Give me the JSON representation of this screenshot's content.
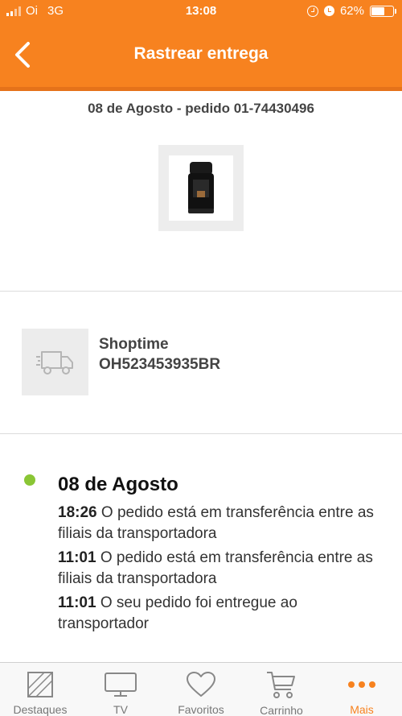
{
  "status_bar": {
    "carrier": "Oi",
    "network": "3G",
    "time": "13:08",
    "battery_percent_label": "62%",
    "battery_level": 0.62
  },
  "header": {
    "title": "Rastrear entrega",
    "back_icon": "chevron-left-icon"
  },
  "order": {
    "summary": "08 de Agosto - pedido 01-74430496",
    "product_image": "coffee-machine"
  },
  "carrier": {
    "icon": "truck-icon",
    "name": "Shoptime",
    "tracking_code": "OH523453935BR"
  },
  "timeline": {
    "date": "08 de Agosto",
    "dot_color": "#8ac635",
    "events": [
      {
        "time": "18:26",
        "text": " O pedido está em transferência entre as filiais da transportadora"
      },
      {
        "time": "11:01",
        "text": " O pedido está em transferência entre as filiais da transportadora"
      },
      {
        "time": "11:01",
        "text": " O seu pedido foi entregue ao transportador"
      }
    ]
  },
  "bottom_nav": {
    "items": [
      {
        "label": "Destaques",
        "icon": "destaques-icon"
      },
      {
        "label": "TV",
        "icon": "tv-icon"
      },
      {
        "label": "Favoritos",
        "icon": "heart-icon"
      },
      {
        "label": "Carrinho",
        "icon": "cart-icon"
      },
      {
        "label": "Mais",
        "icon": "more-dots-icon"
      }
    ],
    "active_index": 4
  },
  "colors": {
    "brand_orange": "#f7821f",
    "success_green": "#8ac635",
    "nav_inactive": "#777777"
  }
}
